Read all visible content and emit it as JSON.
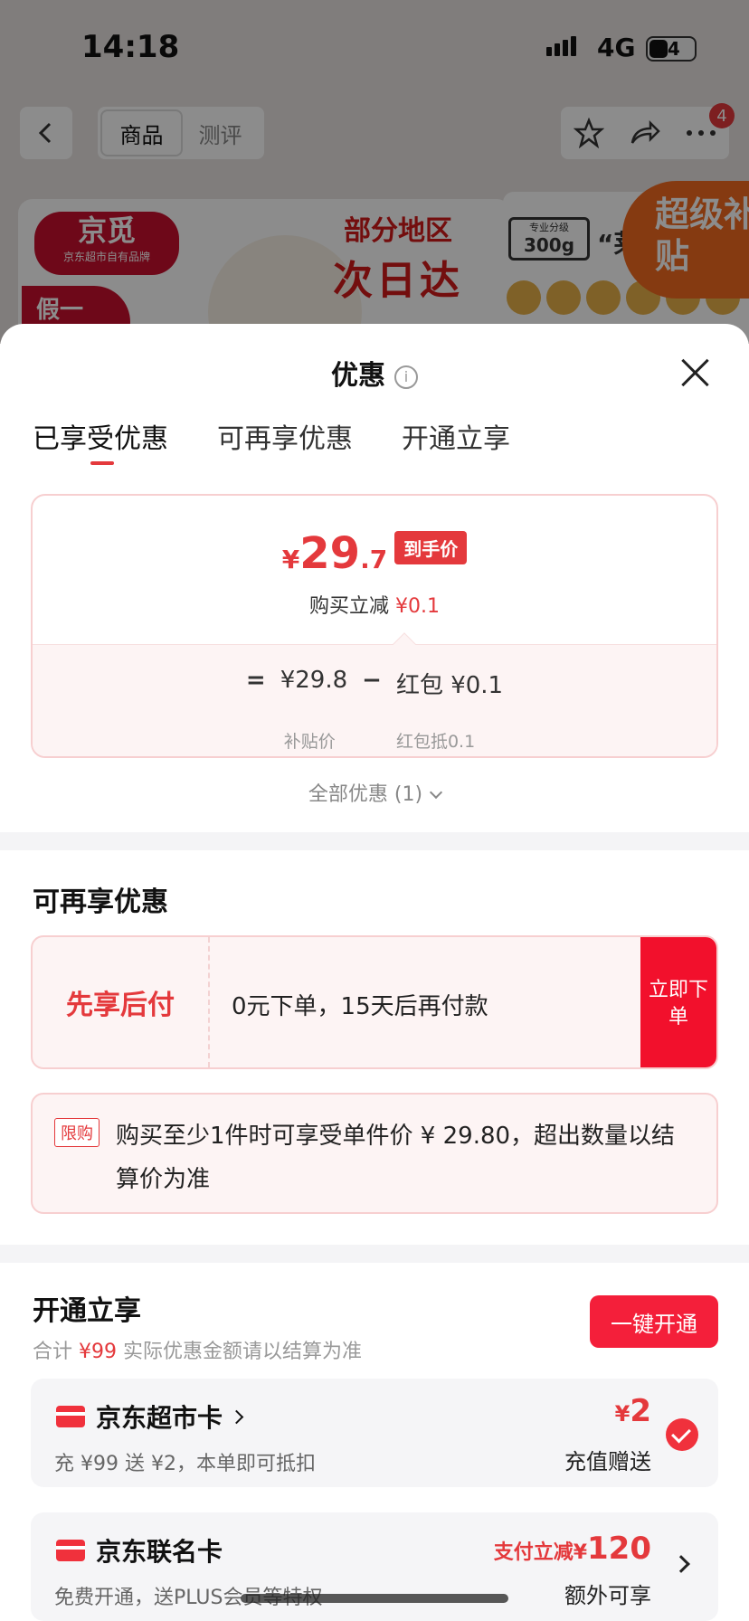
{
  "status_bar": {
    "time": "14:18",
    "network": "4G",
    "battery": "24"
  },
  "nav": {
    "tabs": [
      "商品",
      "测评"
    ],
    "badge_count": "4"
  },
  "background_banner": {
    "brand_name": "京觅",
    "brand_sub": "京东超市自有品牌",
    "fake_label": "假一",
    "promo_line1": "部分地区",
    "promo_line2": "次日达",
    "spec_label": "专业分级",
    "spec_weight": "300g",
    "quote_text": "“莱",
    "super_subsidy": "超级补贴"
  },
  "sheet": {
    "title": "优惠",
    "tabs": [
      "已享受优惠",
      "可再享优惠",
      "开通立享"
    ]
  },
  "price_card": {
    "currency": "¥",
    "price_int": "29",
    "price_dec": ".7",
    "tag": "到手价",
    "discount_label": "购买立减",
    "discount_value": "¥0.1",
    "formula_eq": "=",
    "formula_base": "¥29.8",
    "formula_base_label": "补贴价",
    "formula_minus": "−",
    "formula_deduct": "红包 ¥0.1",
    "formula_deduct_label": "红包抵0.1"
  },
  "all_discounts": "全部优惠 (1)",
  "more_discounts": {
    "title": "可再享优惠",
    "bnpl_label": "先享后付",
    "bnpl_text": "0元下单，15天后再付款",
    "bnpl_button": "立即下单",
    "limit_tag": "限购",
    "limit_text": "购买至少1件时可享受单件价 ¥ 29.80，超出数量以结算价为准"
  },
  "open_now": {
    "title": "开通立享",
    "sub_prefix": "合计",
    "sub_amount": "¥99",
    "sub_suffix": "实际优惠金额请以结算为准",
    "button": "一键开通",
    "cards": [
      {
        "name": "京东超市卡",
        "desc": "充 ¥99 送 ¥2，本单即可抵扣",
        "amount_currency": "¥",
        "amount": "2",
        "amount_label": "充值赠送",
        "selected": true
      },
      {
        "name": "京东联名卡",
        "desc": "免费开通，送PLUS会员等特权",
        "amount_prefix": "支付立减¥",
        "amount": "120",
        "amount_label": "额外可享"
      }
    ]
  },
  "colors": {
    "accent": "#e4393c",
    "button": "#f41f3a",
    "card_border": "#f7cfd0"
  }
}
